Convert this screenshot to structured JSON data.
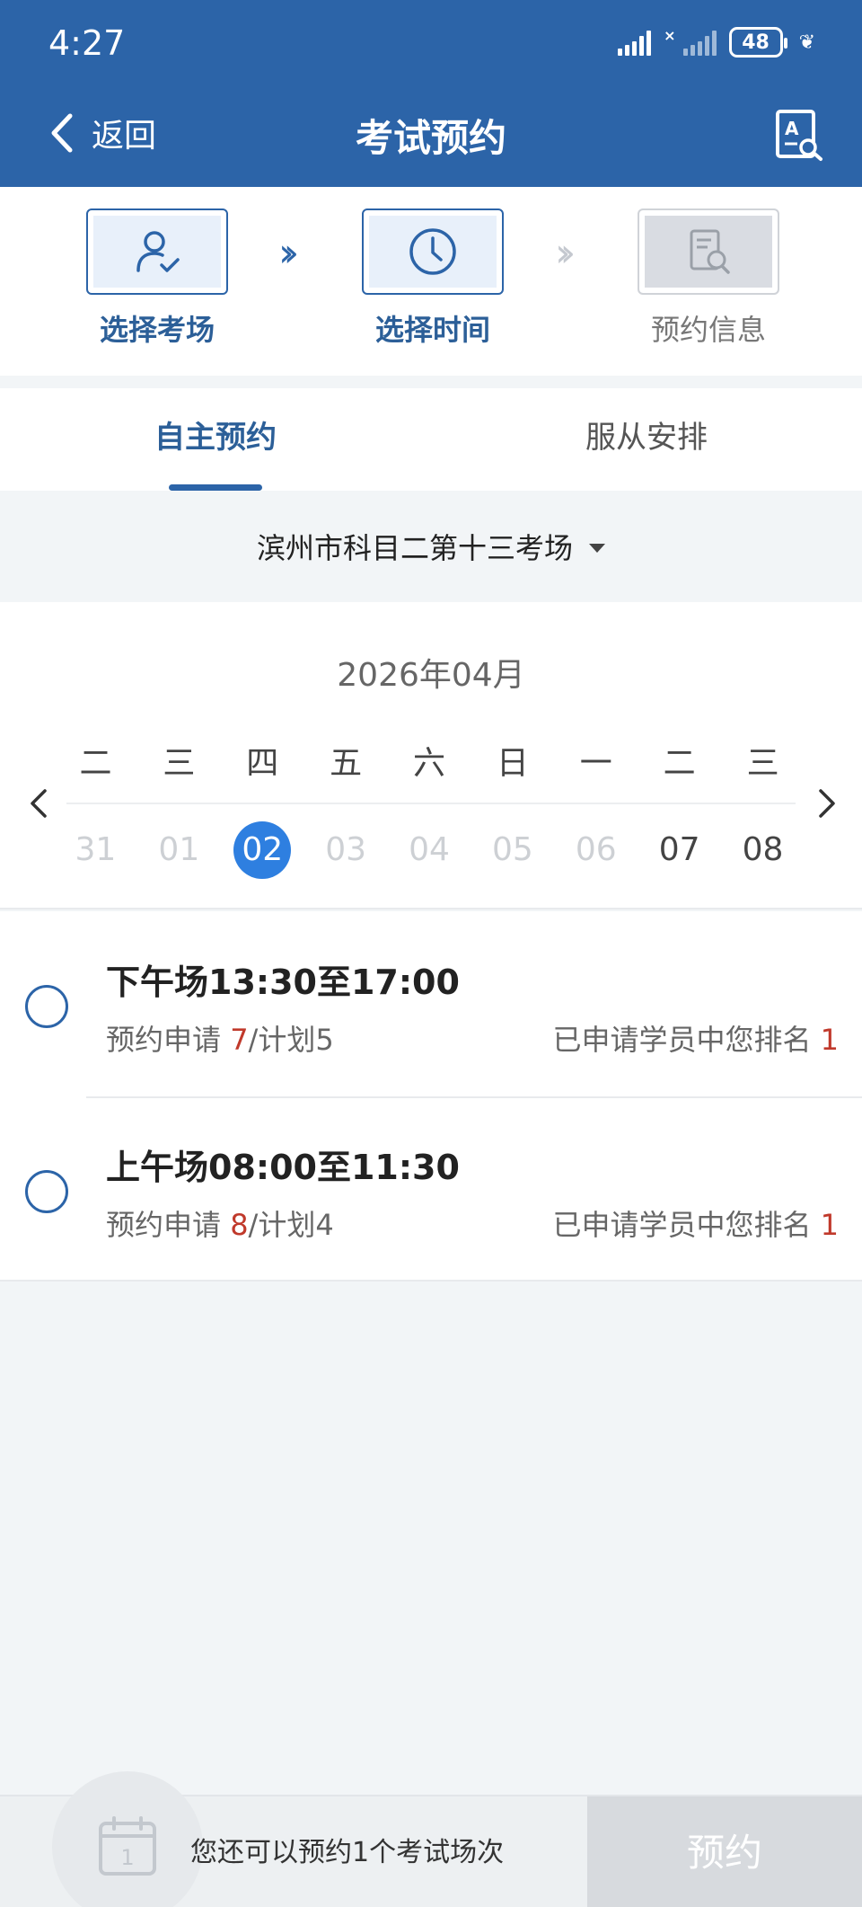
{
  "status_bar": {
    "time": "4:27",
    "battery": "48"
  },
  "header": {
    "back_label": "返回",
    "title": "考试预约"
  },
  "steps": [
    {
      "label": "选择考场",
      "icon": "user-check-icon"
    },
    {
      "label": "选择时间",
      "icon": "clock-icon"
    },
    {
      "label": "预约信息",
      "icon": "document-search-icon"
    }
  ],
  "tabs": [
    {
      "label": "自主预约",
      "active": true
    },
    {
      "label": "服从安排",
      "active": false
    }
  ],
  "venue": {
    "name": "滨州市科目二第十三考场"
  },
  "calendar": {
    "month": "2026年04月",
    "weekdays": [
      "二",
      "三",
      "四",
      "五",
      "六",
      "日",
      "一",
      "二",
      "三"
    ],
    "dates": [
      {
        "label": "31",
        "state": "disabled"
      },
      {
        "label": "01",
        "state": "disabled"
      },
      {
        "label": "02",
        "state": "selected"
      },
      {
        "label": "03",
        "state": "disabled"
      },
      {
        "label": "04",
        "state": "disabled"
      },
      {
        "label": "05",
        "state": "disabled"
      },
      {
        "label": "06",
        "state": "disabled"
      },
      {
        "label": "07",
        "state": "available"
      },
      {
        "label": "08",
        "state": "available"
      }
    ]
  },
  "sessions": [
    {
      "title": "下午场13:30至17:00",
      "apply_label": "预约申请",
      "apply_count": "7",
      "plan_label": "/计划5",
      "rank_label": "已申请学员中您排名",
      "rank": "1"
    },
    {
      "title": "上午场08:00至11:30",
      "apply_label": "预约申请",
      "apply_count": "8",
      "plan_label": "/计划4",
      "rank_label": "已申请学员中您排名",
      "rank": "1"
    }
  ],
  "footer": {
    "calendar_day": "1",
    "remaining_text": "您还可以预约1个考试场次",
    "book_label": "预约"
  },
  "colors": {
    "primary": "#2c64a8",
    "selected_date": "#2e7fe0",
    "count_highlight": "#c0392b",
    "disabled_button": "#d7dade"
  }
}
